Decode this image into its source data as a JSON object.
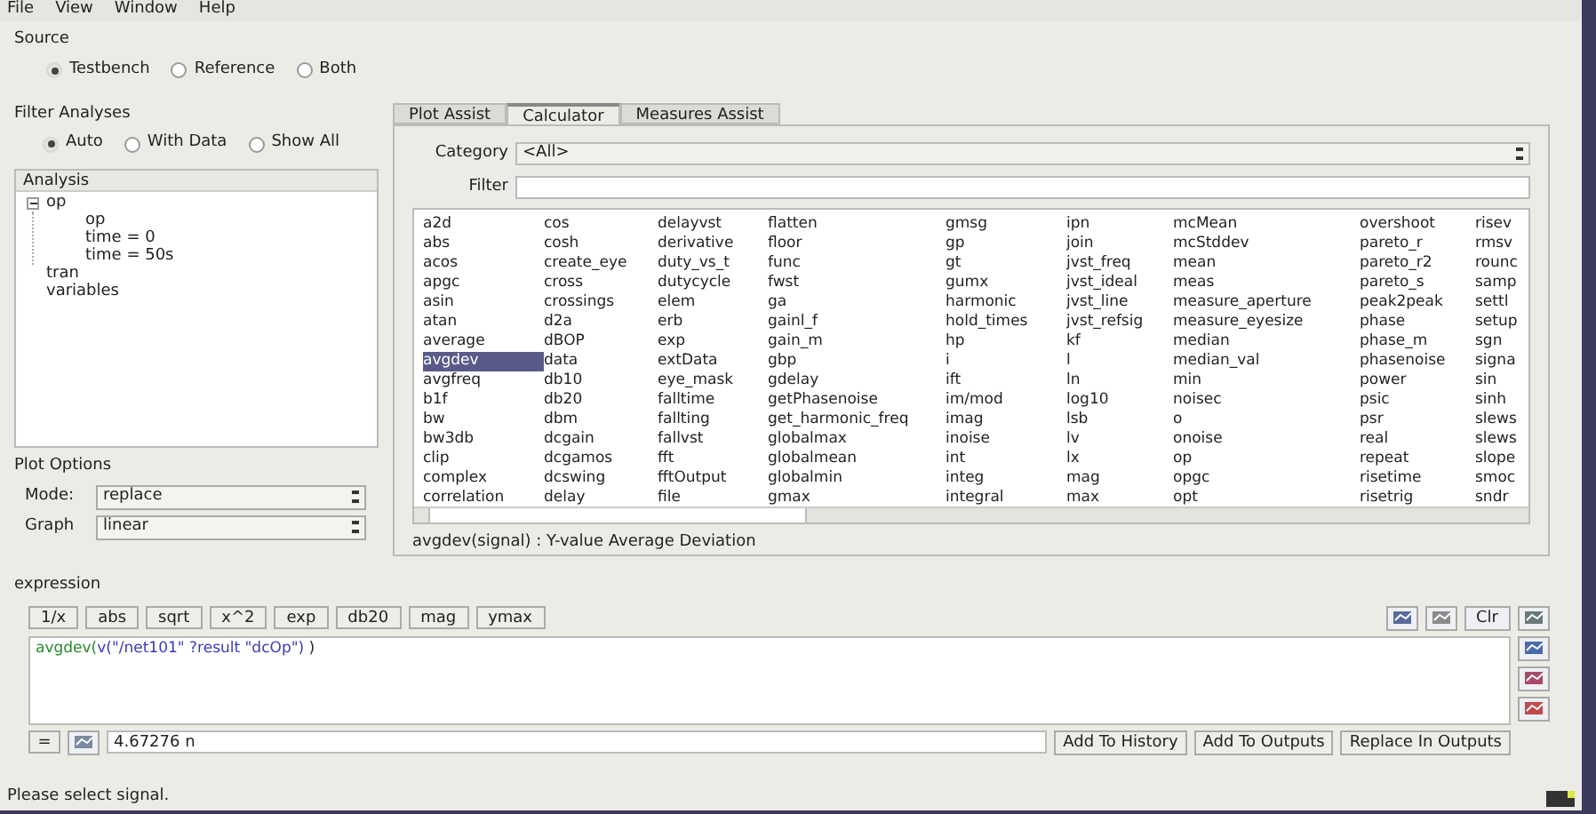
{
  "menu": [
    "File",
    "View",
    "Window",
    "Help"
  ],
  "source": {
    "title": "Source",
    "options": [
      {
        "label": "Testbench",
        "selected": true
      },
      {
        "label": "Reference",
        "selected": false
      },
      {
        "label": "Both",
        "selected": false
      }
    ]
  },
  "filter_analyses": {
    "title": "Filter Analyses",
    "options": [
      {
        "label": "Auto",
        "selected": true
      },
      {
        "label": "With Data",
        "selected": false
      },
      {
        "label": "Show All",
        "selected": false
      }
    ]
  },
  "analysis": {
    "title": "Analysis",
    "tree": [
      {
        "label": "op",
        "expanded": true,
        "children": [
          {
            "label": "op"
          },
          {
            "label": "time = 0"
          },
          {
            "label": "time = 50s"
          }
        ]
      },
      {
        "label": "tran"
      },
      {
        "label": "variables"
      }
    ]
  },
  "plot_options": {
    "title": "Plot Options",
    "fields": [
      {
        "label": "Mode:",
        "value": "replace"
      },
      {
        "label": "Graph",
        "value": "linear"
      }
    ]
  },
  "tabs": [
    {
      "label": "Plot Assist",
      "selected": false
    },
    {
      "label": "Calculator",
      "selected": true
    },
    {
      "label": "Measures Assist",
      "selected": false
    }
  ],
  "category": {
    "label": "Category",
    "value": "<All>"
  },
  "filter": {
    "label": "Filter"
  },
  "functions": {
    "columns": [
      [
        {
          "name": "a2d",
          "selected": false
        },
        {
          "name": "abs",
          "selected": false
        },
        {
          "name": "acos",
          "selected": false
        },
        {
          "name": "apgc",
          "selected": false
        },
        {
          "name": "asin",
          "selected": false
        },
        {
          "name": "atan",
          "selected": false
        },
        {
          "name": "average",
          "selected": false
        },
        {
          "name": "avgdev",
          "selected": true
        },
        {
          "name": "avgfreq",
          "selected": false
        },
        {
          "name": "b1f",
          "selected": false
        },
        {
          "name": "bw",
          "selected": false
        },
        {
          "name": "bw3db",
          "selected": false
        },
        {
          "name": "clip",
          "selected": false
        },
        {
          "name": "complex",
          "selected": false
        },
        {
          "name": "correlation",
          "selected": false
        }
      ],
      [
        {
          "name": "cos",
          "selected": false
        },
        {
          "name": "cosh",
          "selected": false
        },
        {
          "name": "create_eye",
          "selected": false
        },
        {
          "name": "cross",
          "selected": false
        },
        {
          "name": "crossings",
          "selected": false
        },
        {
          "name": "d2a",
          "selected": false
        },
        {
          "name": "dBOP",
          "selected": false
        },
        {
          "name": "data",
          "selected": false
        },
        {
          "name": "db10",
          "selected": false
        },
        {
          "name": "db20",
          "selected": false
        },
        {
          "name": "dbm",
          "selected": false
        },
        {
          "name": "dcgain",
          "selected": false
        },
        {
          "name": "dcgamos",
          "selected": false
        },
        {
          "name": "dcswing",
          "selected": false
        },
        {
          "name": "delay",
          "selected": false
        }
      ],
      [
        {
          "name": "delayvst",
          "selected": false
        },
        {
          "name": "derivative",
          "selected": false
        },
        {
          "name": "duty_vs_t",
          "selected": false
        },
        {
          "name": "dutycycle",
          "selected": false
        },
        {
          "name": "elem",
          "selected": false
        },
        {
          "name": "erb",
          "selected": false
        },
        {
          "name": "exp",
          "selected": false
        },
        {
          "name": "extData",
          "selected": false
        },
        {
          "name": "eye_mask",
          "selected": false
        },
        {
          "name": "falltime",
          "selected": false
        },
        {
          "name": "fallting",
          "selected": false
        },
        {
          "name": "fallvst",
          "selected": false
        },
        {
          "name": "fft",
          "selected": false
        },
        {
          "name": "fftOutput",
          "selected": false
        },
        {
          "name": "file",
          "selected": false
        }
      ],
      [
        {
          "name": "flatten",
          "selected": false
        },
        {
          "name": "floor",
          "selected": false
        },
        {
          "name": "func",
          "selected": false
        },
        {
          "name": "fwst",
          "selected": false
        },
        {
          "name": "ga",
          "selected": false
        },
        {
          "name": "gainl_f",
          "selected": false
        },
        {
          "name": "gain_m",
          "selected": false
        },
        {
          "name": "gbp",
          "selected": false
        },
        {
          "name": "gdelay",
          "selected": false
        },
        {
          "name": "getPhasenoise",
          "selected": false
        },
        {
          "name": "get_harmonic_freq",
          "selected": false
        },
        {
          "name": "globalmax",
          "selected": false
        },
        {
          "name": "globalmean",
          "selected": false
        },
        {
          "name": "globalmin",
          "selected": false
        },
        {
          "name": "gmax",
          "selected": false
        }
      ],
      [
        {
          "name": "gmsg",
          "selected": false
        },
        {
          "name": "gp",
          "selected": false
        },
        {
          "name": "gt",
          "selected": false
        },
        {
          "name": "gumx",
          "selected": false
        },
        {
          "name": "harmonic",
          "selected": false
        },
        {
          "name": "hold_times",
          "selected": false
        },
        {
          "name": "hp",
          "selected": false
        },
        {
          "name": "i",
          "selected": false
        },
        {
          "name": "ift",
          "selected": false
        },
        {
          "name": "im/mod",
          "selected": false
        },
        {
          "name": "imag",
          "selected": false
        },
        {
          "name": "inoise",
          "selected": false
        },
        {
          "name": "int",
          "selected": false
        },
        {
          "name": "integ",
          "selected": false
        },
        {
          "name": "integral",
          "selected": false
        }
      ],
      [
        {
          "name": "ipn",
          "selected": false
        },
        {
          "name": "join",
          "selected": false
        },
        {
          "name": "jvst_freq",
          "selected": false
        },
        {
          "name": "jvst_ideal",
          "selected": false
        },
        {
          "name": "jvst_line",
          "selected": false
        },
        {
          "name": "jvst_refsig",
          "selected": false
        },
        {
          "name": "kf",
          "selected": false
        },
        {
          "name": "l",
          "selected": false
        },
        {
          "name": "ln",
          "selected": false
        },
        {
          "name": "log10",
          "selected": false
        },
        {
          "name": "lsb",
          "selected": false
        },
        {
          "name": "lv",
          "selected": false
        },
        {
          "name": "lx",
          "selected": false
        },
        {
          "name": "mag",
          "selected": false
        },
        {
          "name": "max",
          "selected": false
        }
      ],
      [
        {
          "name": "mcMean",
          "selected": false
        },
        {
          "name": "mcStddev",
          "selected": false
        },
        {
          "name": "mean",
          "selected": false
        },
        {
          "name": "meas",
          "selected": false
        },
        {
          "name": "measure_aperture",
          "selected": false
        },
        {
          "name": "measure_eyesize",
          "selected": false
        },
        {
          "name": "median",
          "selected": false
        },
        {
          "name": "median_val",
          "selected": false
        },
        {
          "name": "min",
          "selected": false
        },
        {
          "name": "noisec",
          "selected": false
        },
        {
          "name": "o",
          "selected": false
        },
        {
          "name": "onoise",
          "selected": false
        },
        {
          "name": "op",
          "selected": false
        },
        {
          "name": "opgc",
          "selected": false
        },
        {
          "name": "opt",
          "selected": false
        }
      ],
      [
        {
          "name": "overshoot",
          "selected": false
        },
        {
          "name": "pareto_r",
          "selected": false
        },
        {
          "name": "pareto_r2",
          "selected": false
        },
        {
          "name": "pareto_s",
          "selected": false
        },
        {
          "name": "peak2peak",
          "selected": false
        },
        {
          "name": "phase",
          "selected": false
        },
        {
          "name": "phase_m",
          "selected": false
        },
        {
          "name": "phasenoise",
          "selected": false
        },
        {
          "name": "power",
          "selected": false
        },
        {
          "name": "psic",
          "selected": false
        },
        {
          "name": "psr",
          "selected": false
        },
        {
          "name": "real",
          "selected": false
        },
        {
          "name": "repeat",
          "selected": false
        },
        {
          "name": "risetime",
          "selected": false
        },
        {
          "name": "risetrig",
          "selected": false
        }
      ],
      [
        {
          "name": "risev",
          "selected": false
        },
        {
          "name": "rmsv",
          "selected": false
        },
        {
          "name": "rounc",
          "selected": false
        },
        {
          "name": "samp",
          "selected": false
        },
        {
          "name": "settl",
          "selected": false
        },
        {
          "name": "setup",
          "selected": false
        },
        {
          "name": "sgn",
          "selected": false
        },
        {
          "name": "signa",
          "selected": false
        },
        {
          "name": "sin",
          "selected": false
        },
        {
          "name": "sinh",
          "selected": false
        },
        {
          "name": "slews",
          "selected": false
        },
        {
          "name": "slews",
          "selected": false
        },
        {
          "name": "slope",
          "selected": false
        },
        {
          "name": "smoc",
          "selected": false
        },
        {
          "name": "sndr",
          "selected": false
        }
      ]
    ]
  },
  "description": "avgdev(signal) : Y-value Average Deviation",
  "expression": {
    "title": "expression",
    "buttons": [
      "1/x",
      "abs",
      "sqrt",
      "x^2",
      "exp",
      "db20",
      "mag",
      "ymax"
    ],
    "clear_label": "Clr",
    "func_part": "avgdev(",
    "signal_part": "v(\"/net101\" ?result \"dcOp\")",
    "close_part": " )",
    "equals": "=",
    "result": "4.67276 n",
    "actions": [
      "Add To History",
      "Add To Outputs",
      "Replace In Outputs"
    ]
  },
  "status_bar": "Please select signal."
}
